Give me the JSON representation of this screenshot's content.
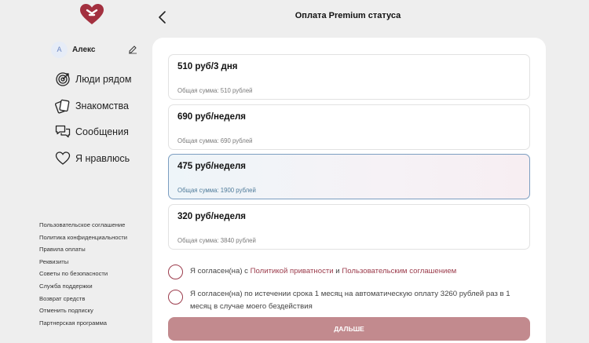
{
  "user": {
    "avatar_letter": "А",
    "name": "Алекс"
  },
  "nav": {
    "items": [
      {
        "label": "Люди рядом",
        "icon": "target-icon"
      },
      {
        "label": "Знакомства",
        "icon": "cards-icon"
      },
      {
        "label": "Сообщения",
        "icon": "chat-icon"
      },
      {
        "label": "Я нравлюсь",
        "icon": "heart-icon"
      }
    ]
  },
  "footer_links": [
    "Пользовательское соглашение",
    "Политика конфиденциальности",
    "Правила оплаты",
    "Реквизиты",
    "Советы по безопасности",
    "Служба поддержки",
    "Возврат средств",
    "Отменить подписку",
    "Партнерская программа"
  ],
  "header": {
    "title": "Оплата Premium статуса"
  },
  "plans": [
    {
      "title": "510 руб/3 дня",
      "total": "Общая сумма: 510 рублей",
      "selected": false
    },
    {
      "title": "690 руб/неделя",
      "total": "Общая сумма: 690 рублей",
      "selected": false
    },
    {
      "title": "475 руб/неделя",
      "total": "Общая сумма: 1900 рублей",
      "selected": true
    },
    {
      "title": "320 руб/неделя",
      "total": "Общая сумма: 3840 рублей",
      "selected": false
    }
  ],
  "agreement": {
    "prefix": "Я согласен(на) с ",
    "privacy_link": "Политикой приватности",
    "and": " и ",
    "terms_link": "Пользовательским соглашением"
  },
  "autopay": {
    "text": "Я согласен(на) по истечении срока 1 месяц на автоматическую оплату 3260 рублей раз в 1 месяц в случае моего бездействия"
  },
  "next_button": {
    "label": "ДАЛЬШЕ"
  },
  "colors": {
    "accent": "#9b3b4b",
    "button": "#c28a8e",
    "selected_border": "#7c9ec1"
  }
}
